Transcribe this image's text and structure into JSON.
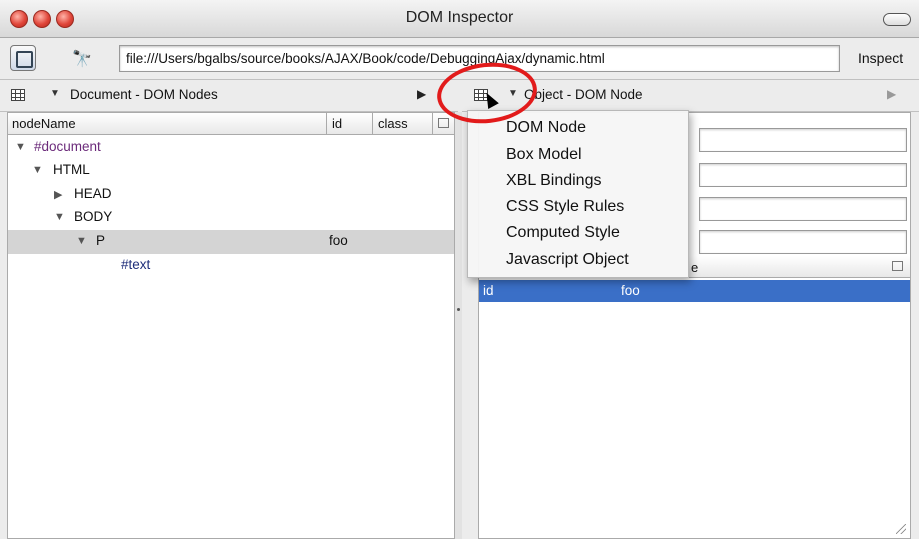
{
  "window": {
    "title": "DOM Inspector",
    "accent": "#3a6fc7"
  },
  "toolbar": {
    "inspect_tool_icon": "node-picker-icon",
    "search_icon": "binoculars-icon",
    "url_value": "file:///Users/bgalbs/source/books/AJAX/Book/code/DebuggingAjax/dynamic.html",
    "inspect_label": "Inspect"
  },
  "left_panel": {
    "title": "Document - DOM Nodes",
    "columns": [
      "nodeName",
      "id",
      "class"
    ],
    "rows": [
      {
        "label": "#document",
        "expanded": true,
        "id": ""
      },
      {
        "label": "HTML",
        "expanded": true,
        "id": ""
      },
      {
        "label": "HEAD",
        "expanded": false,
        "id": ""
      },
      {
        "label": "BODY",
        "expanded": true,
        "id": ""
      },
      {
        "label": "P",
        "expanded": true,
        "id": "foo"
      },
      {
        "label": "#text",
        "expanded": null,
        "id": ""
      }
    ]
  },
  "right_panel": {
    "title": "Object - DOM Node",
    "attr_column_value": "e",
    "attributes": [
      {
        "name": "id",
        "value": "foo"
      }
    ]
  },
  "menu": {
    "items": [
      "DOM Node",
      "Box Model",
      "XBL Bindings",
      "CSS Style Rules",
      "Computed Style",
      "Javascript Object"
    ]
  },
  "icons": {
    "expanded": "▼",
    "collapsed": "▶",
    "arrow_right": "▶",
    "dropdown": "▼"
  }
}
